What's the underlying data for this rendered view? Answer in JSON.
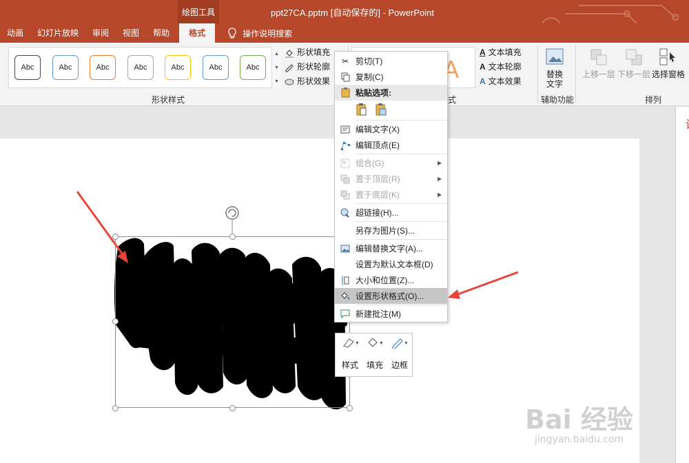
{
  "window": {
    "context_tab": "绘图工具",
    "title": "ppt27CA.pptm [自动保存的]  -  PowerPoint"
  },
  "tabs": {
    "items": [
      "动画",
      "幻灯片放映",
      "审阅",
      "视图",
      "帮助"
    ],
    "active": "格式",
    "tell_me": "操作说明搜索"
  },
  "ribbon": {
    "gallery_label": "Abc",
    "gallery_colors": [
      "#444444",
      "#5b9bd5",
      "#ed7d31",
      "#a5a5a5",
      "#ffc000",
      "#5b9bd5",
      "#70ad47"
    ],
    "shape_fill": "形状填充",
    "shape_outline": "形状轮廓",
    "shape_effects": "形状效果",
    "shape_styles_group": "形状样式",
    "wordart_group_tail": "式",
    "text_fill": "文本填充",
    "text_outline": "文本轮廓",
    "text_effects": "文本效果",
    "alt_text_line1": "替换",
    "alt_text_line2": "文字",
    "accessibility_group": "辅助功能",
    "bring_forward": "上移一层",
    "send_backward": "下移一层",
    "selection_pane": "选择窗格",
    "arrange_group": "排列"
  },
  "context_menu": {
    "cut": "剪切(T)",
    "copy": "复制(C)",
    "paste_options": "粘贴选项:",
    "edit_text": "编辑文字(X)",
    "edit_points": "编辑顶点(E)",
    "group": "组合(G)",
    "bring_to_front": "置于顶层(R)",
    "send_to_back": "置于底层(K)",
    "hyperlink": "超链接(H)...",
    "save_as_picture": "另存为图片(S)...",
    "edit_alt_text": "编辑替换文字(A)...",
    "set_default_textbox": "设置为默认文本框(D)",
    "size_position": "大小和位置(Z)...",
    "format_shape": "设置形状格式(O)...",
    "new_comment": "新建批注(M)"
  },
  "mini_toolbar": {
    "style": "样式",
    "fill": "填充",
    "outline": "边框"
  },
  "right_pane": {
    "title_fragment": "设"
  },
  "watermark": {
    "brand": "Bai 经验",
    "url": "jingyan.baidu.com"
  },
  "colors": {
    "accent": "#b7472a",
    "arrow": "#e8443a"
  }
}
